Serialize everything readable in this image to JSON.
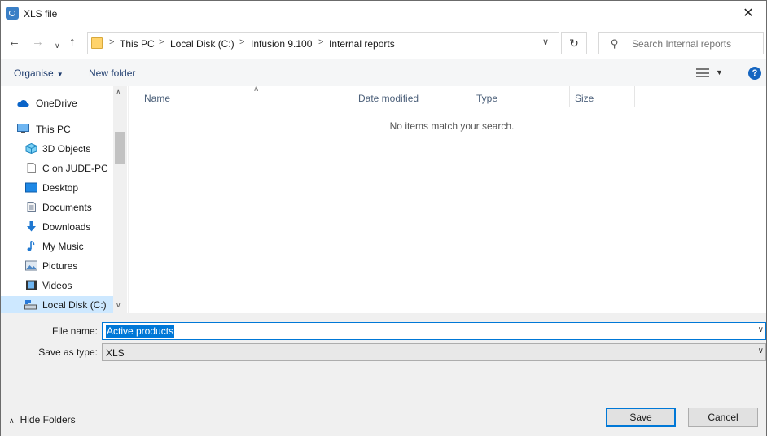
{
  "window": {
    "title": "XLS file",
    "close_glyph": "✕"
  },
  "nav": {
    "back_glyph": "←",
    "forward_glyph": "→",
    "recent_glyph": "∨",
    "up_glyph": "↑",
    "breadcrumbs": [
      "This PC",
      "Local Disk (C:)",
      "Infusion 9.100",
      "Internal reports"
    ],
    "separator_glyph": ">",
    "dropdown_glyph": "∨",
    "refresh_glyph": "↻"
  },
  "search": {
    "placeholder": "Search Internal reports"
  },
  "toolbar": {
    "organise_label": "Organise",
    "new_folder_label": "New folder",
    "help_glyph": "?"
  },
  "sidebar": {
    "items": [
      {
        "label": "OneDrive",
        "icon": "cloud-icon"
      },
      {
        "label": "This PC",
        "icon": "computer-icon"
      },
      {
        "label": "3D Objects",
        "icon": "cube-icon"
      },
      {
        "label": "C on JUDE-PC",
        "icon": "document-icon"
      },
      {
        "label": "Desktop",
        "icon": "desktop-icon"
      },
      {
        "label": "Documents",
        "icon": "documents-icon"
      },
      {
        "label": "Downloads",
        "icon": "download-icon"
      },
      {
        "label": "My Music",
        "icon": "music-icon"
      },
      {
        "label": "Pictures",
        "icon": "pictures-icon"
      },
      {
        "label": "Videos",
        "icon": "video-icon"
      },
      {
        "label": "Local Disk (C:)",
        "icon": "drive-icon"
      }
    ],
    "selected": "Local Disk (C:)"
  },
  "filelist": {
    "columns": [
      "Name",
      "Date modified",
      "Type",
      "Size"
    ],
    "empty_message": "No items match your search."
  },
  "form": {
    "filename_label": "File name:",
    "filename_value": "Active products",
    "savetype_label": "Save as type:",
    "savetype_value": "XLS"
  },
  "footer": {
    "hide_folders_label": "Hide Folders",
    "save_label": "Save",
    "cancel_label": "Cancel"
  },
  "colors": {
    "accent": "#0078d7",
    "selection": "#cde8ff",
    "link": "#1e3c6e"
  }
}
